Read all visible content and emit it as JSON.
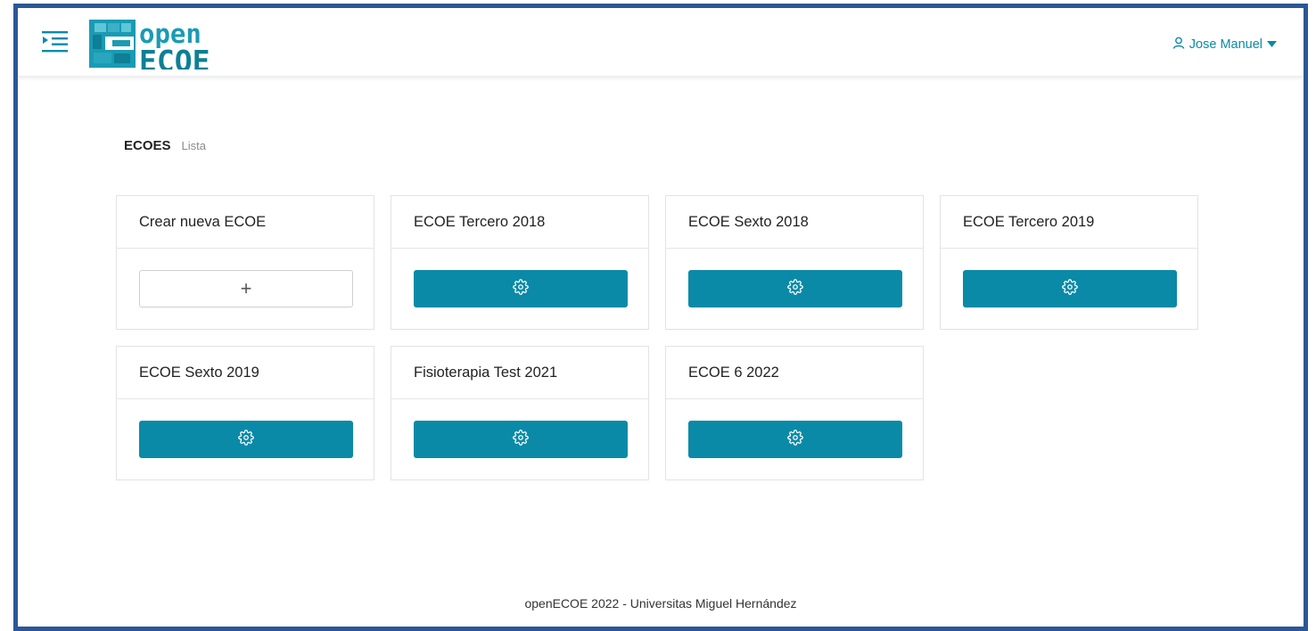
{
  "header": {
    "logo_top": "open",
    "logo_bottom": "ECOE",
    "user_name": "Jose Manuel",
    "brand_color": "#0a8aa7"
  },
  "breadcrumb": {
    "title": "ECOES",
    "subtitle": "Lista"
  },
  "create_card": {
    "title": "Crear nueva ECOE",
    "button_glyph": "+"
  },
  "ecoes": [
    {
      "title": "ECOE Tercero 2018"
    },
    {
      "title": "ECOE Sexto 2018"
    },
    {
      "title": "ECOE Tercero 2019"
    },
    {
      "title": "ECOE Sexto 2019"
    },
    {
      "title": "Fisioterapia Test 2021"
    },
    {
      "title": "ECOE 6 2022"
    }
  ],
  "footer": {
    "text": "openECOE 2022 - Universitas Miguel Hernández"
  }
}
